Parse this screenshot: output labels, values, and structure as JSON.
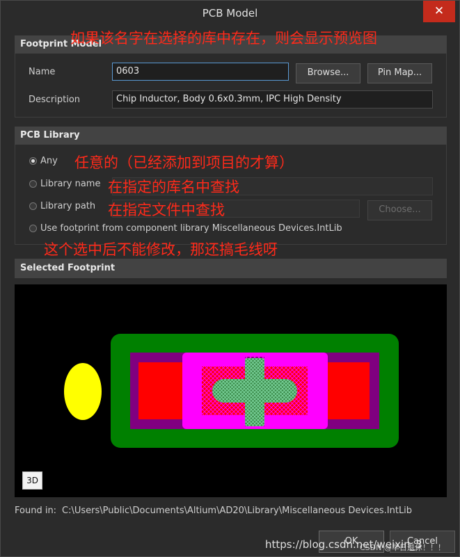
{
  "window": {
    "title": "PCB Model",
    "close_glyph": "✕"
  },
  "footprint_model": {
    "header": "Footprint Model",
    "name_label": "Name",
    "name_value": "0603",
    "browse_label": "Browse...",
    "pinmap_label": "Pin Map...",
    "description_label": "Description",
    "description_value": "Chip Inductor, Body 0.6x0.3mm, IPC High Density"
  },
  "pcb_library": {
    "header": "PCB Library",
    "options": [
      {
        "label": "Any",
        "checked": true
      },
      {
        "label": "Library name",
        "checked": false
      },
      {
        "label": "Library path",
        "checked": false
      },
      {
        "label": "Use footprint from component library Miscellaneous Devices.IntLib",
        "checked": false
      }
    ],
    "choose_label": "Choose..."
  },
  "selected_footprint": {
    "header": "Selected Footprint",
    "btn_3d": "3D",
    "colors": {
      "background": "#000000",
      "courtyard": "#008000",
      "body": "#800080",
      "pad": "#ff0000",
      "pad_mask": "#ff00ff",
      "marker": "#ffff00",
      "cross": "#4caf80"
    }
  },
  "found_in": {
    "label": "Found in:",
    "path": "C:\\Users\\Public\\Documents\\Altium\\AD20\\Library\\Miscellaneous Devices.IntLib"
  },
  "footer": {
    "ok_label": "OK",
    "cancel_label": "Cancel"
  },
  "annotations": {
    "a1": "如果该名字在选择的库中存在，则会显示预览图",
    "a2": "任意的（已经添加到项目的才算）",
    "a3": "在指定的库名中查找",
    "a4": "在指定文件中查找",
    "a5": "这个选中后不能修改，那还搞毛线呀"
  },
  "watermark": {
    "line1": "https://blog.csdn.net/weixin_3",
    "line2": "CSDN @早日退休！！！"
  }
}
